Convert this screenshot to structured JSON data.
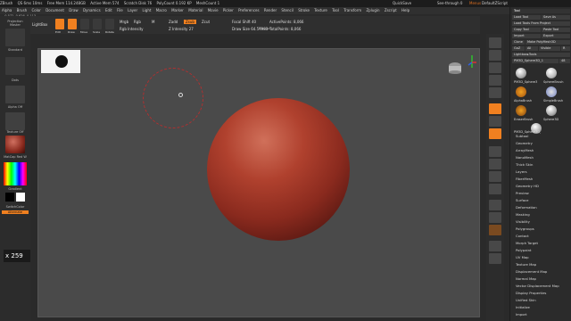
{
  "app": {
    "title": "ZBrush",
    "title_stats": [
      "QS 6ms 10ms",
      "Free Mem 114.248GB",
      "Active Mem 574",
      "Scratch Disk 76",
      "PolyCount 0.192 KP",
      "MeshCount 1"
    ],
    "quicksave": "QuickSave",
    "see_through": "See-through 0",
    "menus_label": "Menus",
    "default_script": "DefaultZScript"
  },
  "menubar": [
    "Alpha",
    "Brush",
    "Color",
    "Document",
    "Draw",
    "Dynamics",
    "Edit",
    "File",
    "Layer",
    "Light",
    "Macro",
    "Marker",
    "Material",
    "Movie",
    "Picker",
    "Preferences",
    "Render",
    "Stencil",
    "Stroke",
    "Texture",
    "Tool",
    "Transform",
    "Zplugin",
    "Zscript",
    "Help"
  ],
  "coords": "-0.572,-0.626,-0.113",
  "toolbar": {
    "projection_master": "Projection Master",
    "lightbox": "LightBox",
    "edit": "Edit",
    "draw": "Draw",
    "move": "Move",
    "scale": "Scale",
    "rotate": "Rotate",
    "mrgb": "Mrgb",
    "rgb": "Rgb",
    "m": "M",
    "rgb_intensity": "Rgb Intensity",
    "zadd": "Zadd",
    "zsub": "Zsub",
    "zcut": "Zcut",
    "z_intensity": "Z Intensity 27",
    "focal_shift": "Focal Shift 40",
    "draw_size": "Draw Size 64.57983",
    "dynamic": "Dynamic",
    "active_points": "ActivePoints: 8,066",
    "total_points": "TotalPoints: 8,066"
  },
  "leftshelf": {
    "brush_label": "Standard",
    "stroke_label": "Dots",
    "alpha_label": "Alpha Off",
    "texture_label": "Texture Off",
    "material_label": "MatCap Red W",
    "gradient_label": "Gradient",
    "switch_color": "SwitchColor",
    "alternate": "Alternate",
    "brush_count": "x 259"
  },
  "tray": {
    "title": "Tool",
    "load_tool": "Load Tool",
    "save_as": "Save As",
    "load_from_project": "Load Tools From Project",
    "copy_tool": "Copy Tool",
    "paste_tool": "Paste Tool",
    "import": "Import",
    "export": "Export",
    "clone": "Clone",
    "make_polymesh": "Make PolyMesh3D",
    "goz": "GoZ",
    "all": "All",
    "visible": "Visible",
    "r": "R",
    "lightbox_tools": "Lightbox▸Tools",
    "current_tool": "PM3D_Sphere3D_1",
    "count": "48",
    "tool_thumbs": [
      "PM3D_Sphere3",
      "SphereBrush",
      "AlphaBrush",
      "SimpleBrush",
      "EraserBrush",
      "Sphere3D",
      "PM3D_Sphere3D_1",
      "PM3D_Sphere3"
    ],
    "subpanels": [
      "Subtool",
      "Geometry",
      "ArrayMesh",
      "NanoMesh",
      "Thick Skin",
      "Layers",
      "FiberMesh",
      "Geometry HD",
      "Preview",
      "Surface",
      "Deformation",
      "Masking",
      "Visibility",
      "Polygroups",
      "Contact",
      "Morph Target",
      "Polypaint",
      "UV Map",
      "Texture Map",
      "Displacement Map",
      "Normal Map",
      "Vector Displacement Map",
      "Display Properties",
      "Unified Skin",
      "Initialize",
      "Import"
    ]
  },
  "rightshelf": [
    "BPR",
    "SPix 3",
    "Scroll",
    "Zoom",
    "Actual",
    "AAHalf",
    "Persp",
    "Floor",
    "Local",
    "LSym",
    "Frame",
    "Move",
    "Zoom3D",
    "Rotate",
    "PolyF",
    "Transp",
    "Ghost",
    "Solo",
    "Xpose"
  ]
}
